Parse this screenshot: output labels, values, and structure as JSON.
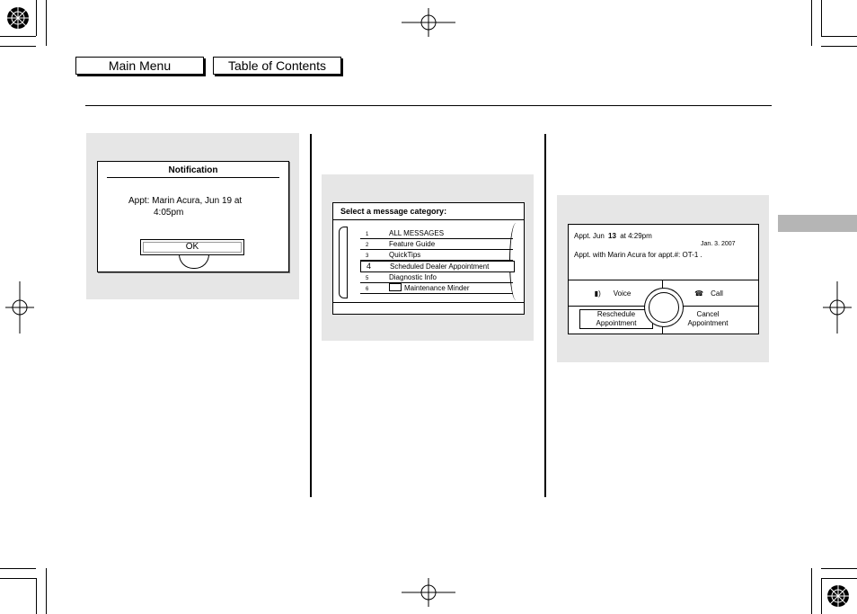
{
  "nav": {
    "main_menu": "Main Menu",
    "toc": "Table of Contents"
  },
  "notification": {
    "title": "Notification",
    "line1": "Appt: Marin Acura, Jun 19 at",
    "line2": "4:05pm",
    "ok": "OK"
  },
  "categories": {
    "title": "Select a message category:",
    "items": [
      {
        "num": "1",
        "label": "ALL MESSAGES"
      },
      {
        "num": "2",
        "label": "Feature Guide"
      },
      {
        "num": "3",
        "label": "QuickTips"
      },
      {
        "num": "4",
        "label": "Scheduled Dealer Appointment"
      },
      {
        "num": "5",
        "label": "Diagnostic Info"
      },
      {
        "num": "6",
        "label": "Maintenance Minder"
      }
    ],
    "selected_index": 3
  },
  "appointment": {
    "line1_prefix": "Appt. Jun",
    "line1_day": "13",
    "line1_suffix": "at  4:29pm",
    "date": "Jan. 3. 2007",
    "line2": "Appt. with Marin Acura for appt.#: OT-1 .",
    "voice": "Voice",
    "call": "Call",
    "reschedule_1": "Reschedule",
    "reschedule_2": "Appointment",
    "cancel_1": "Cancel",
    "cancel_2": "Appointment"
  },
  "colors": {
    "panel_bg": "#e6e6e6",
    "side_tab": "#b5b5b5"
  }
}
